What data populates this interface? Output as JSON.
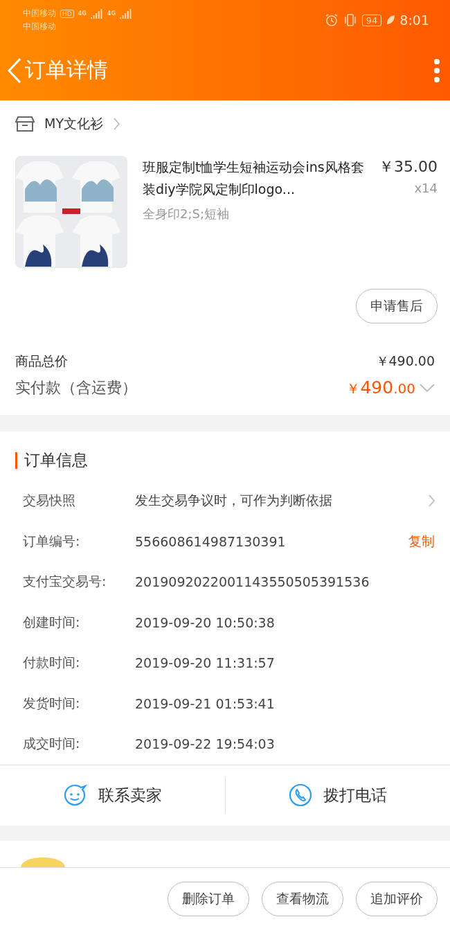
{
  "status_bar": {
    "carriers": [
      "中国移动",
      "中国移动"
    ],
    "hd": "HD",
    "networks": [
      "4G",
      "4G"
    ],
    "battery": "94",
    "time": "8:01"
  },
  "header": {
    "title": "订单详情"
  },
  "shop": {
    "name": "MY文化衫"
  },
  "item": {
    "kind": "picture",
    "title": "班服定制t恤学生短袖运动会ins风格套装diy学院风定制印logo...",
    "price": "￥35.00",
    "quantity": "x14",
    "sku": "全身印2;S;短袖",
    "after_sale": "申请售后"
  },
  "totals": {
    "goods_label": "商品总价",
    "goods_value": "￥490.00",
    "paid_label": "实付款（含运费）",
    "paid_currency": "￥",
    "paid_int": "490",
    "paid_dec": ".00"
  },
  "order_info": {
    "title": "订单信息",
    "rows": [
      {
        "label": "交易快照",
        "value": "发生交易争议时，可作为判断依据",
        "kind": "link"
      },
      {
        "label": "订单编号:",
        "value": "556608614987130391",
        "kind": "copy",
        "action": "复制"
      },
      {
        "label": "支付宝交易号:",
        "value": "2019092022001143550505391536",
        "kind": "plain"
      },
      {
        "label": "创建时间:",
        "value": "2019-09-20 10:50:38",
        "kind": "plain"
      },
      {
        "label": "付款时间:",
        "value": "2019-09-20 11:31:57",
        "kind": "plain"
      },
      {
        "label": "发货时间:",
        "value": "2019-09-21 01:53:41",
        "kind": "plain"
      },
      {
        "label": "成交时间:",
        "value": "2019-09-22 19:54:03",
        "kind": "plain"
      }
    ]
  },
  "contact": [
    {
      "label": "联系卖家",
      "kind": "chat"
    },
    {
      "label": "拨打电话",
      "kind": "phone"
    }
  ],
  "bottom_buttons": [
    "删除订单",
    "查看物流",
    "追加评价"
  ]
}
